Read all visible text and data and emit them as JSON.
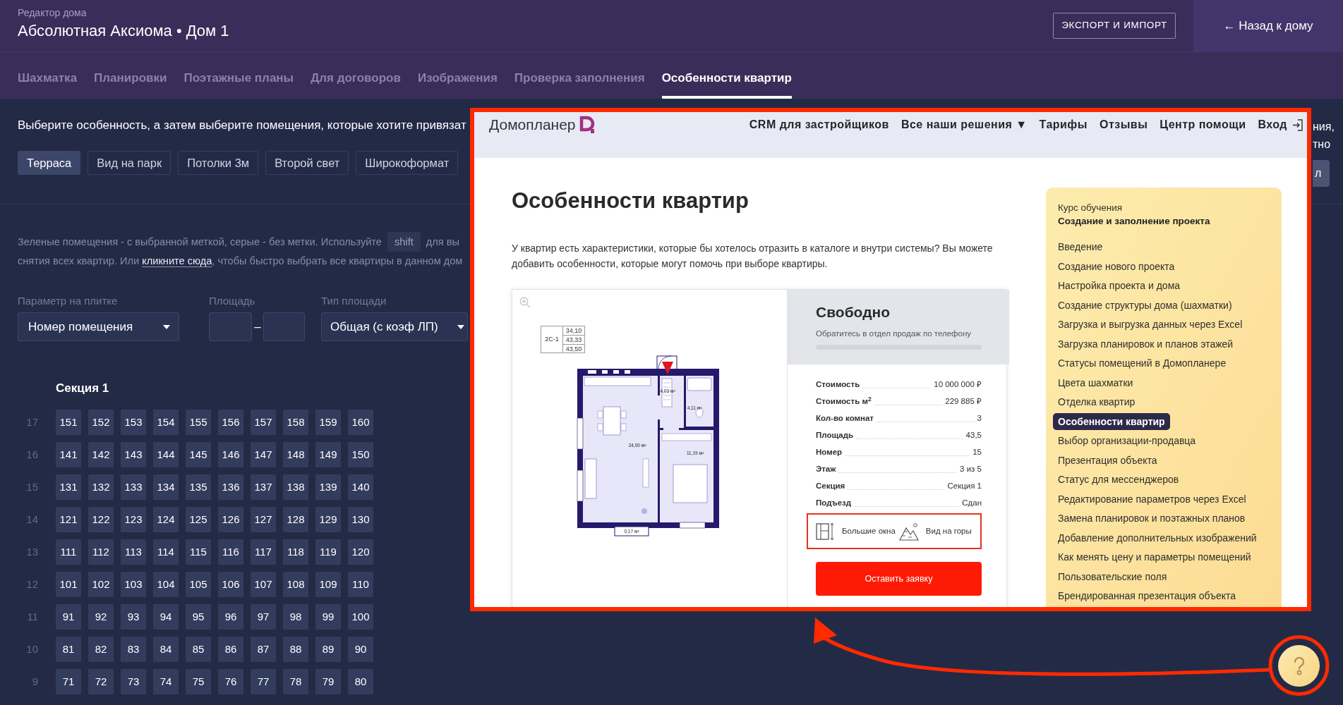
{
  "header": {
    "caption": "Редактор дома",
    "title": "Абсолютная Аксиома • Дом 1",
    "export_button": "ЭКСПОРТ И ИМПОРТ",
    "back_link": "← Назад к дому"
  },
  "tabs": [
    {
      "label": "Шахматка",
      "selected": false
    },
    {
      "label": "Планировки",
      "selected": false
    },
    {
      "label": "Поэтажные планы",
      "selected": false
    },
    {
      "label": "Для договоров",
      "selected": false
    },
    {
      "label": "Изображения",
      "selected": false
    },
    {
      "label": "Проверка заполнения",
      "selected": false
    },
    {
      "label": "Особенности квартир",
      "selected": true
    }
  ],
  "instruction": "Выберите особенность, а затем выберите помещения, которые хотите привязат",
  "features": [
    {
      "label": "Терраса",
      "selected": true
    },
    {
      "label": "Вид на парк",
      "selected": false
    },
    {
      "label": "Потолки 3м",
      "selected": false
    },
    {
      "label": "Второй свет",
      "selected": false
    },
    {
      "label": "Широкоформат",
      "selected": false
    }
  ],
  "edge_fragments": {
    "lines": [
      "ния,",
      "тно"
    ],
    "button": "л"
  },
  "hint": {
    "before_key": "Зеленые помещения - с выбранной меткой, серые - без метки. Используйте",
    "key": "shift",
    "after_key": "для вы",
    "line_2_before_link": "снятия всех квартир. Или",
    "link": "кликните сюда",
    "line_2_after_link": ", чтобы быстро выбрать все квартиры в данном дом"
  },
  "filters": {
    "tile_parameter": {
      "label": "Параметр на плитке",
      "value": "Номер помещения"
    },
    "area": {
      "label": "Площадь",
      "separator": "–"
    },
    "area_type": {
      "label": "Тип площади",
      "value": "Общая (с коэф ЛП)"
    }
  },
  "section": {
    "title": "Секция 1",
    "floors": [
      {
        "floor": "17",
        "apartments": [
          "151",
          "152",
          "153",
          "154",
          "155",
          "156",
          "157",
          "158",
          "159",
          "160"
        ]
      },
      {
        "floor": "16",
        "apartments": [
          "141",
          "142",
          "143",
          "144",
          "145",
          "146",
          "147",
          "148",
          "149",
          "150"
        ]
      },
      {
        "floor": "15",
        "apartments": [
          "131",
          "132",
          "133",
          "134",
          "135",
          "136",
          "137",
          "138",
          "139",
          "140"
        ]
      },
      {
        "floor": "14",
        "apartments": [
          "121",
          "122",
          "123",
          "124",
          "125",
          "126",
          "127",
          "128",
          "129",
          "130"
        ]
      },
      {
        "floor": "13",
        "apartments": [
          "111",
          "112",
          "113",
          "114",
          "115",
          "116",
          "117",
          "118",
          "119",
          "120"
        ]
      },
      {
        "floor": "12",
        "apartments": [
          "101",
          "102",
          "103",
          "104",
          "105",
          "106",
          "107",
          "108",
          "109",
          "110"
        ]
      },
      {
        "floor": "11",
        "apartments": [
          "91",
          "92",
          "93",
          "94",
          "95",
          "96",
          "97",
          "98",
          "99",
          "100"
        ]
      },
      {
        "floor": "10",
        "apartments": [
          "81",
          "82",
          "83",
          "84",
          "85",
          "86",
          "87",
          "88",
          "89",
          "90"
        ]
      },
      {
        "floor": "9",
        "apartments": [
          "71",
          "72",
          "73",
          "74",
          "75",
          "76",
          "77",
          "78",
          "79",
          "80"
        ]
      }
    ]
  },
  "tutorial": {
    "brand": "Домопланер",
    "nav_links": [
      {
        "label": "CRM для застройщиков",
        "kind": "link"
      },
      {
        "label": "Все наши решения ▼",
        "kind": "link"
      },
      {
        "label": "Тарифы",
        "kind": "link"
      },
      {
        "label": "Отзывы",
        "kind": "link"
      },
      {
        "label": "Центр помощи",
        "kind": "link"
      },
      {
        "label": "Вход",
        "kind": "login"
      }
    ],
    "heading": "Особенности квартир",
    "intro": "У квартир есть характеристики, которые бы хотелось отразить в каталоге и внутри системы? Вы можете добавить особенности, которые могут помочь при выборе квартиры.",
    "plan": {
      "type_code": "2С-1",
      "areas": [
        "34,10",
        "43,33",
        "43,50"
      ],
      "room_labels": [
        "4,03 м²",
        "4,11 м²",
        "24,00 м²",
        "11,19 м²",
        "0,17 м²"
      ]
    },
    "listing": {
      "status": "Свободно",
      "status_note": "Обратитесь в отдел продаж по телефону",
      "properties": [
        {
          "label": "Стоимость",
          "value": "10 000 000 ₽"
        },
        {
          "label": "Стоимость м$^{2}$",
          "value": "229 885 ₽"
        },
        {
          "label": "Кол-во комнат",
          "value": "3"
        },
        {
          "label": "Площадь",
          "value": "43,5"
        },
        {
          "label": "Номер",
          "value": "15"
        },
        {
          "label": "Этаж",
          "value": "3 из 5"
        },
        {
          "label": "Секция",
          "value": "Секция 1"
        },
        {
          "label": "Подъезд",
          "value": "Сдан"
        }
      ],
      "tags": [
        {
          "kind": "windows",
          "label": "Большие окна"
        },
        {
          "kind": "mountains",
          "label": "Вид на горы"
        }
      ],
      "request_button": "Оставить заявку"
    },
    "course": {
      "caption": "Курс обучения",
      "title": "Создание и заполнение проекта",
      "lessons": [
        {
          "label": "Введение",
          "selected": false
        },
        {
          "label": "Создание нового проекта",
          "selected": false
        },
        {
          "label": "Настройка проекта и дома",
          "selected": false
        },
        {
          "label": "Создание структуры дома (шахматки)",
          "selected": false
        },
        {
          "label": "Загрузка и выгрузка данных через Excel",
          "selected": false
        },
        {
          "label": "Загрузка планировок и планов этажей",
          "selected": false
        },
        {
          "label": "Статусы помещений в Домопланере",
          "selected": false
        },
        {
          "label": "Цвета шахматки",
          "selected": false
        },
        {
          "label": "Отделка квартир",
          "selected": false
        },
        {
          "label": "Особенности квартир",
          "selected": true
        },
        {
          "label": "Выбор организации-продавца",
          "selected": false
        },
        {
          "label": "Презентация объекта",
          "selected": false
        },
        {
          "label": "Статус для мессенджеров",
          "selected": false
        },
        {
          "label": "Редактирование параметров через Excel",
          "selected": false
        },
        {
          "label": "Замена планировок и поэтажных планов",
          "selected": false
        },
        {
          "label": "Добавление дополнительных изображений",
          "selected": false
        },
        {
          "label": "Как менять цену и параметры помещений",
          "selected": false
        },
        {
          "label": "Пользовательские поля",
          "selected": false
        },
        {
          "label": "Брендированная презентация объекта",
          "selected": false
        }
      ]
    }
  }
}
